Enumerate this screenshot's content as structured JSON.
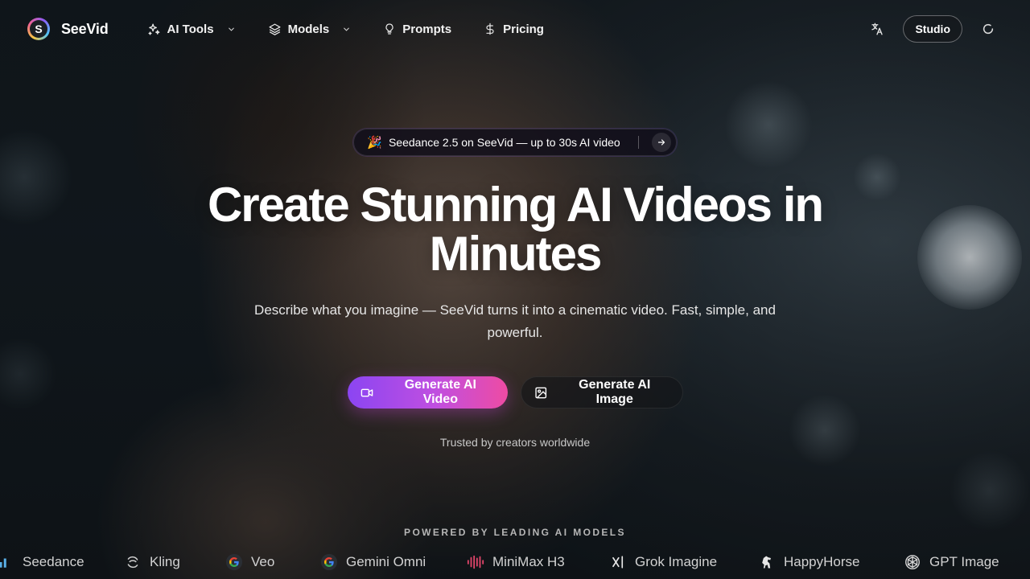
{
  "brand": {
    "name": "SeeVid",
    "logo_letter": "S"
  },
  "nav": {
    "items": [
      {
        "label": "AI Tools",
        "icon": "sparkles-icon",
        "has_dropdown": true
      },
      {
        "label": "Models",
        "icon": "layers-icon",
        "has_dropdown": true
      },
      {
        "label": "Prompts",
        "icon": "lightbulb-icon",
        "has_dropdown": false
      },
      {
        "label": "Pricing",
        "icon": "dollar-icon",
        "has_dropdown": false
      }
    ]
  },
  "header": {
    "language_icon": "translate-icon",
    "studio_label": "Studio",
    "loading_icon": "spinner-icon"
  },
  "announcement": {
    "emoji": "🎉",
    "text": "Seedance 2.5 on SeeVid — up to 30s AI video"
  },
  "hero": {
    "title_line1": "Create Stunning AI Videos in",
    "title_line2": "Minutes",
    "subtitle": "Describe what you imagine — SeeVid turns it into a cinematic video. Fast, simple, and powerful.",
    "primary_cta": "Generate AI Video",
    "secondary_cta": "Generate AI Image",
    "trusted": "Trusted by creators worldwide"
  },
  "models_section": {
    "heading": "POWERED BY LEADING AI MODELS",
    "models": [
      {
        "name": "Seedance",
        "icon": "seedance-bars-icon"
      },
      {
        "name": "Kling",
        "icon": "kling-icon"
      },
      {
        "name": "Veo",
        "icon": "google-g-icon"
      },
      {
        "name": "Gemini Omni",
        "icon": "google-g-icon"
      },
      {
        "name": "MiniMax H3",
        "icon": "minimax-wave-icon"
      },
      {
        "name": "Grok Imagine",
        "icon": "xai-icon"
      },
      {
        "name": "HappyHorse",
        "icon": "horse-icon"
      },
      {
        "name": "GPT Image",
        "icon": "openai-icon"
      }
    ]
  },
  "colors": {
    "accent_start": "#8b45f2",
    "accent_end": "#ee4ba3",
    "background": "#0f1418"
  }
}
